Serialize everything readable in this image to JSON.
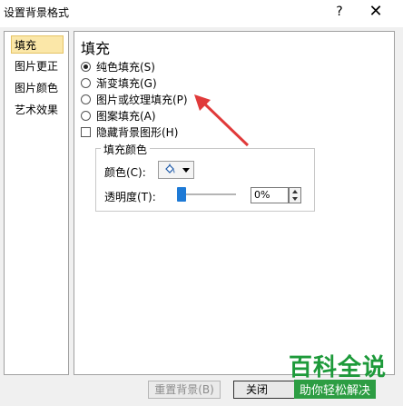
{
  "window": {
    "title": "设置背景格式",
    "help": "?",
    "close": "✕"
  },
  "nav": {
    "items": [
      {
        "label": "填充",
        "selected": true
      },
      {
        "label": "图片更正",
        "selected": false
      },
      {
        "label": "图片颜色",
        "selected": false
      },
      {
        "label": "艺术效果",
        "selected": false
      }
    ]
  },
  "panel": {
    "heading": "填充",
    "options": [
      {
        "label": "纯色填充(S)",
        "type": "radio",
        "checked": true
      },
      {
        "label": "渐变填充(G)",
        "type": "radio",
        "checked": false
      },
      {
        "label": "图片或纹理填充(P)",
        "type": "radio",
        "checked": false
      },
      {
        "label": "图案填充(A)",
        "type": "radio",
        "checked": false
      },
      {
        "label": "隐藏背景图形(H)",
        "type": "checkbox",
        "checked": false
      }
    ],
    "group": {
      "legend": "填充颜色",
      "color_label": "颜色(C):",
      "color_icon": "paint-bucket-icon",
      "transparency_label": "透明度(T):",
      "transparency_value": "0%",
      "transparency_fraction": 0
    }
  },
  "buttons": {
    "reset": "重置背景(B)",
    "close": "关闭"
  },
  "watermark": {
    "title": "百科全说",
    "subtitle": "助你轻松解决"
  },
  "colors": {
    "annotation_arrow": "#e03a3a",
    "nav_selected_bg": "#fbe7a8",
    "slider_thumb": "#1e7ad6",
    "watermark_green": "#1d9a3a"
  }
}
